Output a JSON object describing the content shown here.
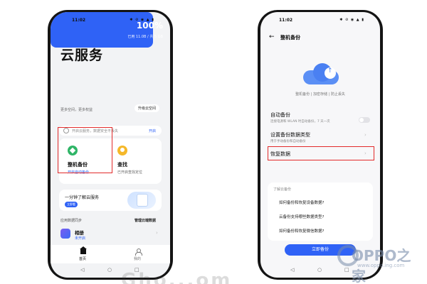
{
  "status_bar": {
    "time": "11:02",
    "icons_text": "✱ ⊘ ◉ ▲ ▮"
  },
  "left_phone": {
    "title": "云服务",
    "storage": {
      "percent": "100%",
      "used_text": "已用 11.0B / 共 5 GB",
      "fill_fraction": 1.0
    },
    "more_space_text": "更多空间，更多权益",
    "upgrade_button": "升级云空间",
    "tip": {
      "text": "开启云服务，数据安全不丢失",
      "action": "开启"
    },
    "features": [
      {
        "name": "整机备份",
        "sub": "开启自动备份",
        "icon": "backup-icon"
      },
      {
        "name": "查找",
        "sub": "已开启查找定位",
        "icon": "find-icon"
      }
    ],
    "promo": {
      "text": "一分钟了解云服务",
      "badge": "立即看"
    },
    "sync_section": {
      "title": "应用数据同步",
      "manage": "管理云端数据"
    },
    "album": {
      "name": "相册",
      "status": "未开启"
    },
    "tabs": [
      {
        "label": "首页",
        "icon": "home-icon"
      },
      {
        "label": "我的",
        "icon": "user-icon"
      }
    ],
    "nav": {
      "back": "◁",
      "home": "○",
      "recent": "□"
    }
  },
  "right_phone": {
    "title": "整机备份",
    "back_icon": "←",
    "features_text": "整机备份 | 加密存储 | 防止丢失",
    "rows": [
      {
        "title": "自动备份",
        "sub": "连接电源和 WLAN 时自动备份，7 天一次",
        "has_toggle": true
      },
      {
        "title": "设置备份数据类型",
        "sub": "用于手动备份和自动备份"
      },
      {
        "title": "恢复数据",
        "sub": ""
      }
    ],
    "faq": {
      "title": "了解云备份",
      "items": [
        "如何备份和恢复设备数据?",
        "云备份支持哪些数据类型?",
        "如何备份和恢复微信数据?"
      ]
    },
    "primary_button": "立即备份",
    "nav": {
      "back": "◁",
      "home": "○",
      "recent": "□"
    }
  },
  "watermark": {
    "brand": "OPPO之家",
    "url": "www.oppo.ing.com",
    "bottom_text": "Gho...om"
  },
  "colors": {
    "accent": "#2f62f6",
    "highlight": "#e22a2a",
    "phone_frame": "#141414"
  }
}
